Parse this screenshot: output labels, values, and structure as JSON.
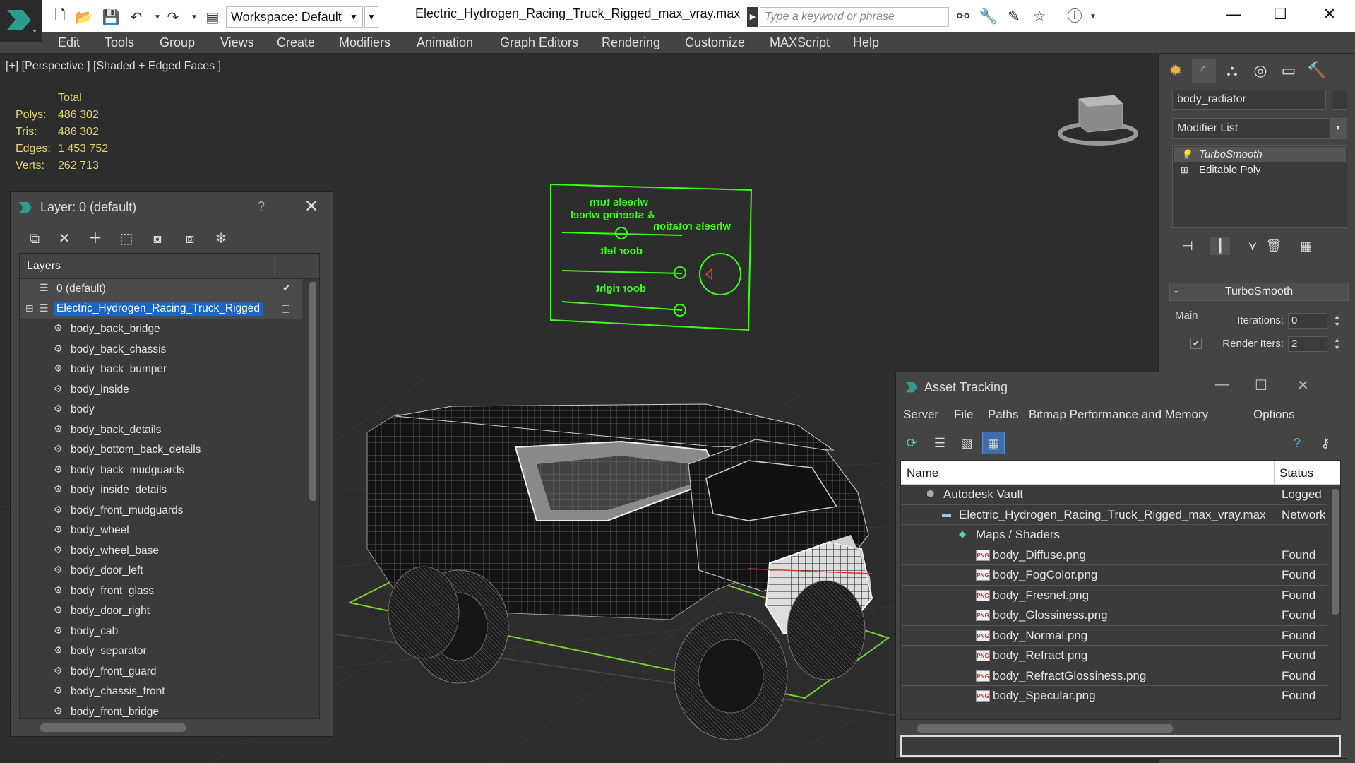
{
  "app": {
    "workspace": "Workspace: Default",
    "document_title": "Electric_Hydrogen_Racing_Truck_Rigged_max_vray.max",
    "search_placeholder": "Type a keyword or phrase"
  },
  "menu": [
    "Edit",
    "Tools",
    "Group",
    "Views",
    "Create",
    "Modifiers",
    "Animation",
    "Graph Editors",
    "Rendering",
    "Customize",
    "MAXScript",
    "Help"
  ],
  "viewport": {
    "label": "[+] [Perspective ] [Shaded + Edged Faces ]",
    "stats": {
      "header": "Total",
      "rows": [
        {
          "key": "Polys:",
          "value": "486 302"
        },
        {
          "key": "Tris:",
          "value": "486 302"
        },
        {
          "key": "Edges:",
          "value": "1 453 752"
        },
        {
          "key": "Verts:",
          "value": "262 713"
        }
      ]
    },
    "rig_panel": {
      "labels": [
        "wheels turn",
        "& steering wheel",
        "wheels rotation",
        "door left",
        "door right"
      ]
    }
  },
  "command_panel": {
    "object_name": "body_radiator",
    "modifier_list": "Modifier List",
    "stack": [
      "TurboSmooth",
      "Editable Poly"
    ],
    "rollout": {
      "title": "TurboSmooth",
      "collapse": "-",
      "group": "Main",
      "iterations_label": "Iterations:",
      "iterations_value": "0",
      "render_iters_label": "Render Iters:",
      "render_iters_value": "2"
    }
  },
  "layer_dialog": {
    "title": "Layer: 0 (default)",
    "help": "?",
    "column_header": "Layers",
    "layers": [
      {
        "label": "0 (default)",
        "check": "✔"
      },
      {
        "label": "Electric_Hydrogen_Racing_Truck_Rigged"
      }
    ],
    "objects": [
      "body_back_bridge",
      "body_back_chassis",
      "body_back_bumper",
      "body_inside",
      "body",
      "body_back_details",
      "body_bottom_back_details",
      "body_back_mudguards",
      "body_inside_details",
      "body_front_mudguards",
      "body_wheel",
      "body_wheel_base",
      "body_door_left",
      "body_front_glass",
      "body_door_right",
      "body_cab",
      "body_separator",
      "body_front_guard",
      "body_chassis_front",
      "body_front_bridge"
    ]
  },
  "asset_dialog": {
    "title": "Asset Tracking",
    "menu": [
      "Server",
      "File",
      "Paths",
      "Bitmap Performance and Memory",
      "Options"
    ],
    "columns": {
      "name": "Name",
      "status": "Status"
    },
    "rows": [
      {
        "name": "Autodesk Vault",
        "status": "Logged",
        "level": 0
      },
      {
        "name": "Electric_Hydrogen_Racing_Truck_Rigged_max_vray.max",
        "status": "Network",
        "level": 1
      },
      {
        "name": "Maps / Shaders",
        "status": "",
        "level": 2
      },
      {
        "name": "body_Diffuse.png",
        "status": "Found",
        "level": 3
      },
      {
        "name": "body_FogColor.png",
        "status": "Found",
        "level": 3
      },
      {
        "name": "body_Fresnel.png",
        "status": "Found",
        "level": 3
      },
      {
        "name": "body_Glossiness.png",
        "status": "Found",
        "level": 3
      },
      {
        "name": "body_Normal.png",
        "status": "Found",
        "level": 3
      },
      {
        "name": "body_Refract.png",
        "status": "Found",
        "level": 3
      },
      {
        "name": "body_RefractGlossiness.png",
        "status": "Found",
        "level": 3
      },
      {
        "name": "body_Specular.png",
        "status": "Found",
        "level": 3
      }
    ]
  },
  "colors": {
    "stats_yellow": "#e3d36c",
    "rig_green": "#39ff14",
    "selection_blue": "#1a66c6"
  }
}
